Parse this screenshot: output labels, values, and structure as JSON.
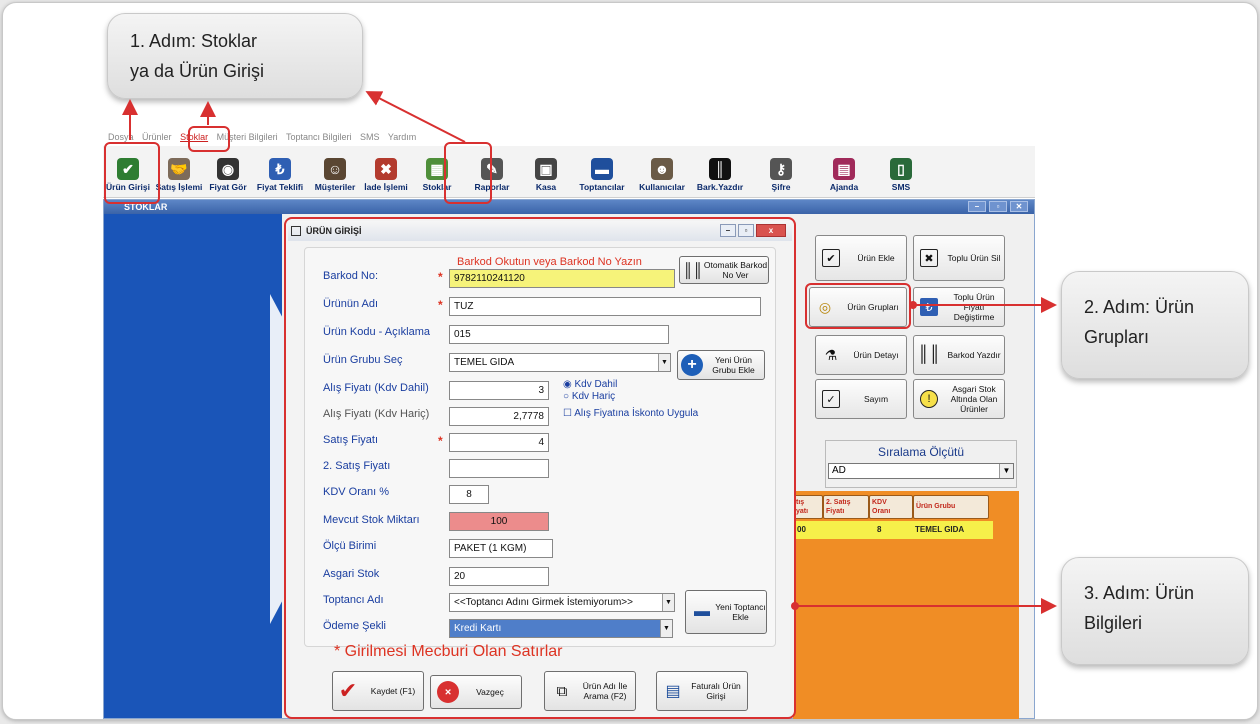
{
  "callouts": {
    "step1": {
      "line1": "1. Adım: Stoklar",
      "line2": "ya da Ürün Girişi"
    },
    "step2": {
      "line1": "2. Adım: Ürün",
      "line2": "Grupları"
    },
    "step3": {
      "line1": "3. Adım: Ürün",
      "line2": "Bilgileri"
    }
  },
  "menu": [
    "Dosya",
    "Ürünler",
    "Stoklar",
    "Müşteri Bilgileri",
    "Toptancı Bilgileri",
    "SMS",
    "Yardım"
  ],
  "toolbar": [
    {
      "label": "Ürün Girişi",
      "icon": "checklist-icon",
      "color": "#2e7d32"
    },
    {
      "label": "Satış İşlemi",
      "icon": "handshake-icon",
      "color": "#7d6b5a"
    },
    {
      "label": "Fiyat Gör",
      "icon": "eye-icon",
      "color": "#333333"
    },
    {
      "label": "Fiyat Teklifi",
      "icon": "lira-icon",
      "color": "#2f5fb3"
    },
    {
      "label": "Müşteriler",
      "icon": "people-icon",
      "color": "#5a4632"
    },
    {
      "label": "İade İşlemi",
      "icon": "return-icon",
      "color": "#b33b2e"
    },
    {
      "label": "Stoklar",
      "icon": "shelf-icon",
      "color": "#4f8f3a"
    },
    {
      "label": "Raporlar",
      "icon": "report-icon",
      "color": "#555555"
    },
    {
      "label": "Kasa",
      "icon": "safe-icon",
      "color": "#444444"
    },
    {
      "label": "Toptancılar",
      "icon": "truck-icon",
      "color": "#1f4f9c"
    },
    {
      "label": "Kullanıcılar",
      "icon": "users-icon",
      "color": "#6a5a46"
    },
    {
      "label": "Bark.Yazdır",
      "icon": "barcode-icon",
      "color": "#111111"
    },
    {
      "label": "Şifre",
      "icon": "key-icon",
      "color": "#555555"
    },
    {
      "label": "Ajanda",
      "icon": "calendar-icon",
      "color": "#a02a5a"
    },
    {
      "label": "SMS",
      "icon": "phone-icon",
      "color": "#2a6a3a"
    }
  ],
  "stoklar_window": {
    "title": "STOKLAR",
    "buttons": [
      {
        "label": "Ürün Ekle",
        "icon": "check-icon"
      },
      {
        "label": "Toplu Ürün Sil",
        "icon": "delete-icon"
      },
      {
        "label": "Ürün Grupları",
        "icon": "coins-icon"
      },
      {
        "label": "Toplu Ürün Fiyatı Değiştirme",
        "icon": "price-change-icon"
      },
      {
        "label": "Ürün Detayı",
        "icon": "microscope-icon"
      },
      {
        "label": "Barkod Yazdır",
        "icon": "barcode-icon"
      },
      {
        "label": "Sayım",
        "icon": "count-icon"
      },
      {
        "label": "Asgari Stok Altında Olan Ürünler",
        "icon": "warning-icon"
      }
    ],
    "sort_label": "Sıralama Ölçütü",
    "sort_value": "AD",
    "grid_headers": [
      "tış\nyatı",
      "2. Satış\nFiyatı",
      "KDV\nOranı",
      "Ürün Grubu"
    ],
    "grid_row": [
      "00",
      "",
      "8",
      "TEMEL GIDA"
    ]
  },
  "dialog": {
    "title": "ÜRÜN GİRİŞİ",
    "barcode_hint": "Barkod Okutun  veya  Barkod No Yazın",
    "auto_barcode_button": "Otomatik Barkod No Ver",
    "fields": {
      "barkod_label": "Barkod No:",
      "barkod_value": "9782110241120",
      "urun_adi_label": "Ürünün Adı",
      "urun_adi_value": "TUZ",
      "urun_kodu_label": "Ürün Kodu - Açıklama",
      "urun_kodu_value": "015",
      "urun_grubu_label": "Ürün Grubu Seç",
      "urun_grubu_value": "TEMEL GIDA",
      "alis_dahil_label": "Alış Fiyatı (Kdv Dahil)",
      "alis_dahil_value": "3",
      "alis_haric_label": "Alış Fiyatı (Kdv Hariç)",
      "alis_haric_value": "2,7778",
      "satis_label": "Satış Fiyatı",
      "satis_value": "4",
      "satis2_label": "2. Satış Fiyatı",
      "satis2_value": "",
      "kdv_label": "KDV Oranı %",
      "kdv_value": "8",
      "mevcut_label": "Mevcut Stok Miktarı",
      "mevcut_value": "100",
      "olcu_label": "Ölçü Birimi",
      "olcu_value": "PAKET (1 KGM)",
      "asgari_label": "Asgari Stok",
      "asgari_value": "20",
      "toptanci_label": "Toptancı Adı",
      "toptanci_value": "<<Toptancı Adını Girmek İstemiyorum>>",
      "odeme_label": "Ödeme Şekli",
      "odeme_value": "Kredi Kartı"
    },
    "new_group_button": "Yeni Ürün Grubu Ekle",
    "kdv_dahil": "Kdv Dahil",
    "kdv_haric": "Kdv Hariç",
    "iskonto": "Alış Fiyatına İskonto Uygula",
    "new_supplier_button": "Yeni Toptancı Ekle",
    "required_note": "*  Girilmesi Mecburi Olan Satırlar",
    "bottom_buttons": [
      {
        "label": "Kaydet (F1)",
        "icon": "checkmark-icon"
      },
      {
        "label": "Vazgeç",
        "icon": "cancel-icon"
      },
      {
        "label": "Ürün Adı İle Arama (F2)",
        "icon": "binoculars-icon"
      },
      {
        "label": "Faturalı Ürün Girişi",
        "icon": "invoice-icon"
      }
    ]
  },
  "colors": {
    "highlight": "#d83030",
    "title_blue": "#3a63a8",
    "left_panel": "#1a55b8",
    "grid_orange": "#f08d25"
  }
}
